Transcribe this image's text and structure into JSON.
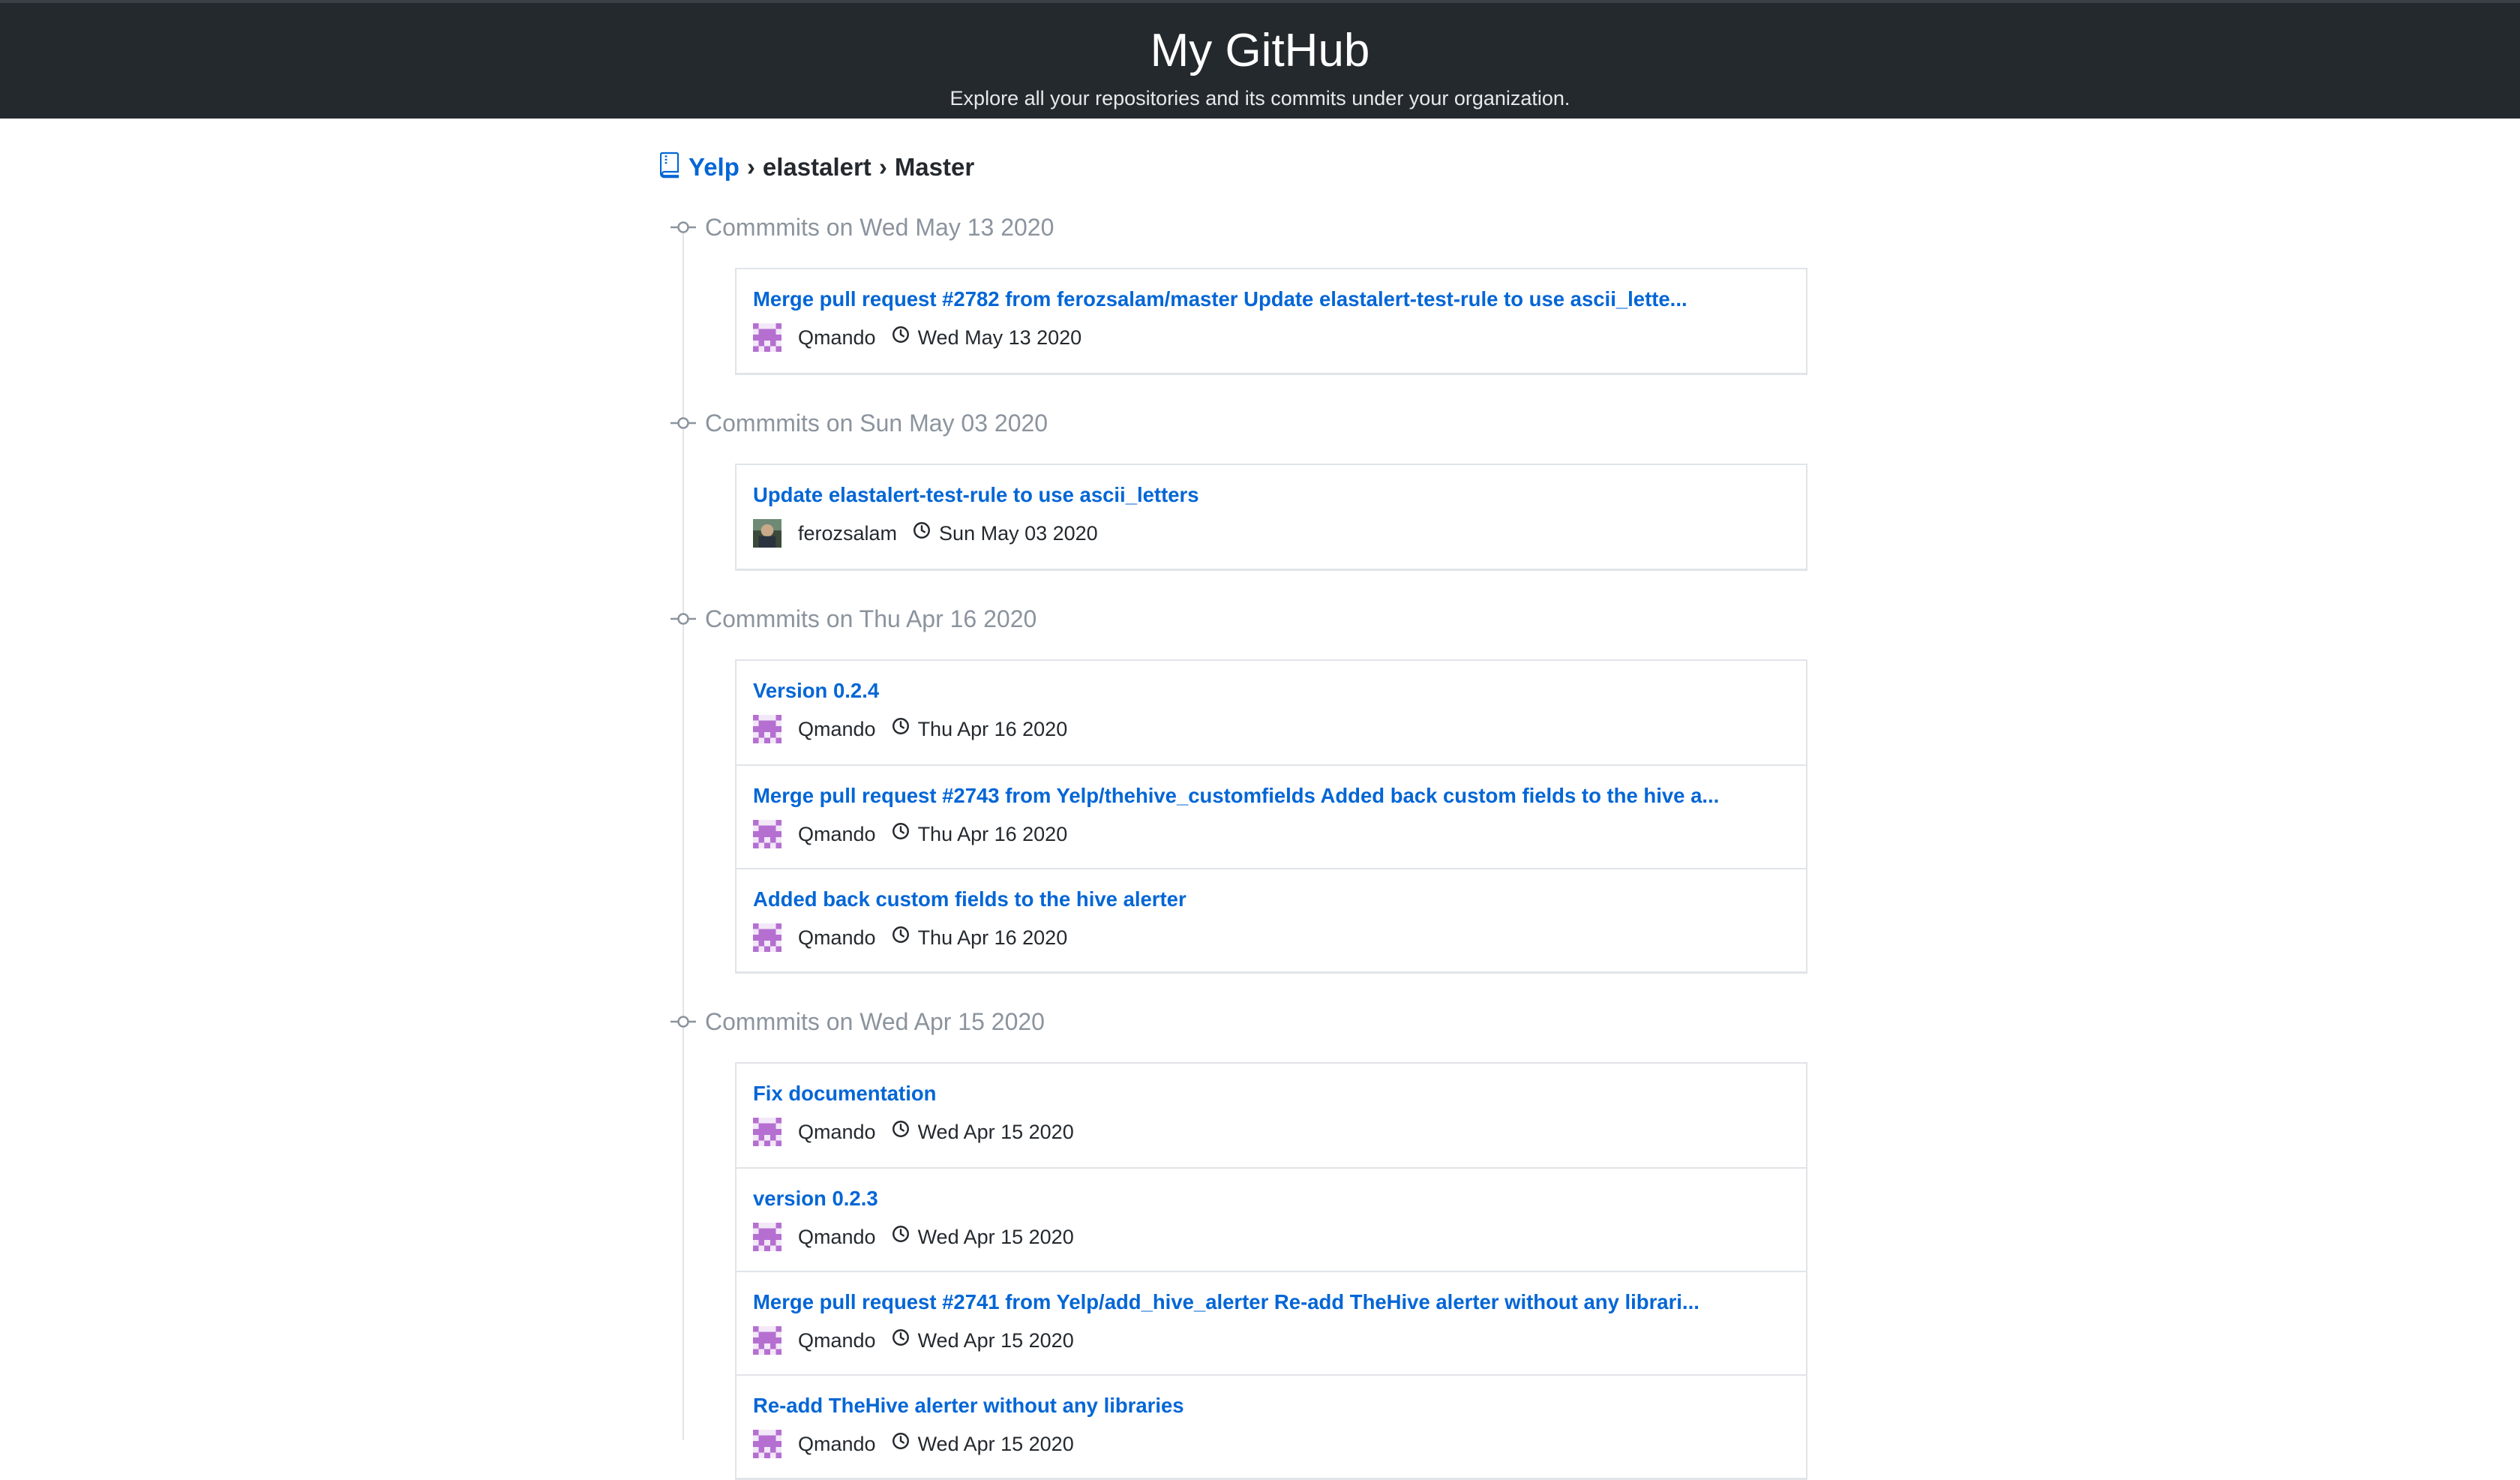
{
  "header": {
    "title": "My GitHub",
    "subtitle": "Explore all your repositories and its commits under your organization."
  },
  "breadcrumb": {
    "org": "Yelp",
    "separator": "›",
    "repo": "elastalert",
    "branch": "Master"
  },
  "icons": {
    "repo": "repo-icon",
    "commit_node": "git-commit-icon",
    "clock": "clock-icon",
    "avatar_identicon": "identicon-avatar"
  },
  "colors": {
    "header_bg": "#24292e",
    "link": "#0366d6",
    "muted": "#8b949e",
    "identicon": "#b56fd1"
  },
  "groups": [
    {
      "title": "Commmits on Wed May 13 2020",
      "commits": [
        {
          "message": "Merge pull request #2782 from ferozsalam/master Update elastalert-test-rule to use ascii_lette...",
          "author": "Qmando",
          "date": "Wed May 13 2020",
          "avatar": "identicon"
        }
      ]
    },
    {
      "title": "Commmits on Sun May 03 2020",
      "commits": [
        {
          "message": "Update elastalert-test-rule to use ascii_letters",
          "author": "ferozsalam",
          "date": "Sun May 03 2020",
          "avatar": "photo"
        }
      ]
    },
    {
      "title": "Commmits on Thu Apr 16 2020",
      "commits": [
        {
          "message": "Version 0.2.4",
          "author": "Qmando",
          "date": "Thu Apr 16 2020",
          "avatar": "identicon"
        },
        {
          "message": "Merge pull request #2743 from Yelp/thehive_customfields Added back custom fields to the hive a...",
          "author": "Qmando",
          "date": "Thu Apr 16 2020",
          "avatar": "identicon"
        },
        {
          "message": "Added back custom fields to the hive alerter",
          "author": "Qmando",
          "date": "Thu Apr 16 2020",
          "avatar": "identicon"
        }
      ]
    },
    {
      "title": "Commmits on Wed Apr 15 2020",
      "commits": [
        {
          "message": "Fix documentation",
          "author": "Qmando",
          "date": "Wed Apr 15 2020",
          "avatar": "identicon"
        },
        {
          "message": "version 0.2.3",
          "author": "Qmando",
          "date": "Wed Apr 15 2020",
          "avatar": "identicon"
        },
        {
          "message": "Merge pull request #2741 from Yelp/add_hive_alerter Re-add TheHive alerter without any librari...",
          "author": "Qmando",
          "date": "Wed Apr 15 2020",
          "avatar": "identicon"
        },
        {
          "message": "Re-add TheHive alerter without any libraries",
          "author": "Qmando",
          "date": "Wed Apr 15 2020",
          "avatar": "identicon"
        }
      ]
    }
  ]
}
